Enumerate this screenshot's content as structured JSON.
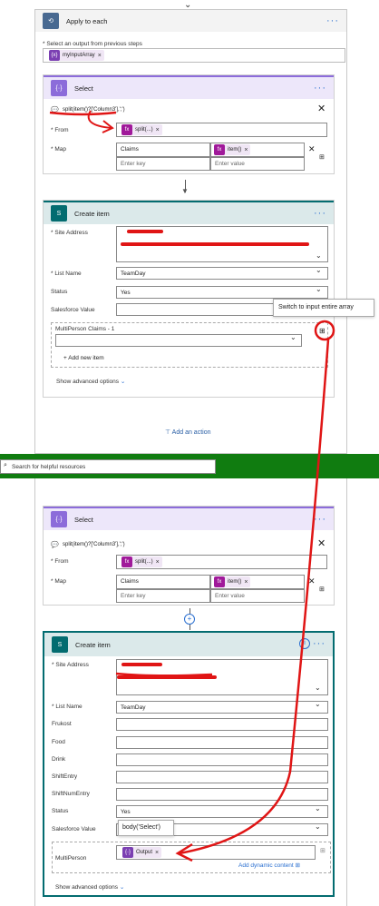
{
  "colors": {
    "select": "#8c6cda",
    "sharepoint": "#036c70",
    "token_fx": "#a0199a",
    "token_var": "#7b3fb2",
    "loop": "#486991",
    "bar": "#107c10",
    "annotation": "#e01515"
  },
  "apply_each": {
    "title": "Apply to each",
    "prompt": "* Select an output from previous steps",
    "token": "myInputArray"
  },
  "select1": {
    "title": "Select",
    "comment": "split(item()?['Column3'],';')",
    "from_label": "* From",
    "from_token": "split(...)",
    "map_label": "* Map",
    "map_key": "Claims",
    "map_val_token": "item()",
    "key_placeholder": "Enter key",
    "val_placeholder": "Enter value"
  },
  "create1": {
    "title": "Create item",
    "site_label": "* Site Address",
    "list_label": "* List Name",
    "list_value": "TeamDay",
    "status_label": "Status",
    "status_value": "Yes",
    "sf_label": "Salesforce Value",
    "mp_label": "MultiPerson Claims - 1",
    "add_new": "Add new item",
    "adv": "Show advanced options",
    "tooltip": "Switch to input entire array"
  },
  "add_action": "Add an action",
  "searchbar": {
    "placeholder": "Search for helpful resources"
  },
  "select2": {
    "title": "Select",
    "comment": "split(item()?['Column3'],';')",
    "from_label": "* From",
    "from_token": "split(...)",
    "map_label": "* Map",
    "map_key": "Claims",
    "map_val_token": "item()",
    "key_placeholder": "Enter key",
    "val_placeholder": "Enter value"
  },
  "create2": {
    "title": "Create item",
    "site_label": "* Site Address",
    "list_label": "* List Name",
    "list_value": "TeamDay",
    "frukost": "Frukost",
    "food": "Food",
    "drink": "Drink",
    "shiftentry": "ShiftEntry",
    "shiftnum": "ShiftNumEntry",
    "status_label": "Status",
    "status_value": "Yes",
    "sf_label": "Salesforce Value",
    "body_tip": "body('Select')",
    "mp_label": "MultiPerson",
    "output_token": "Output",
    "add_dynamic": "Add dynamic content",
    "adv": "Show advanced options"
  }
}
